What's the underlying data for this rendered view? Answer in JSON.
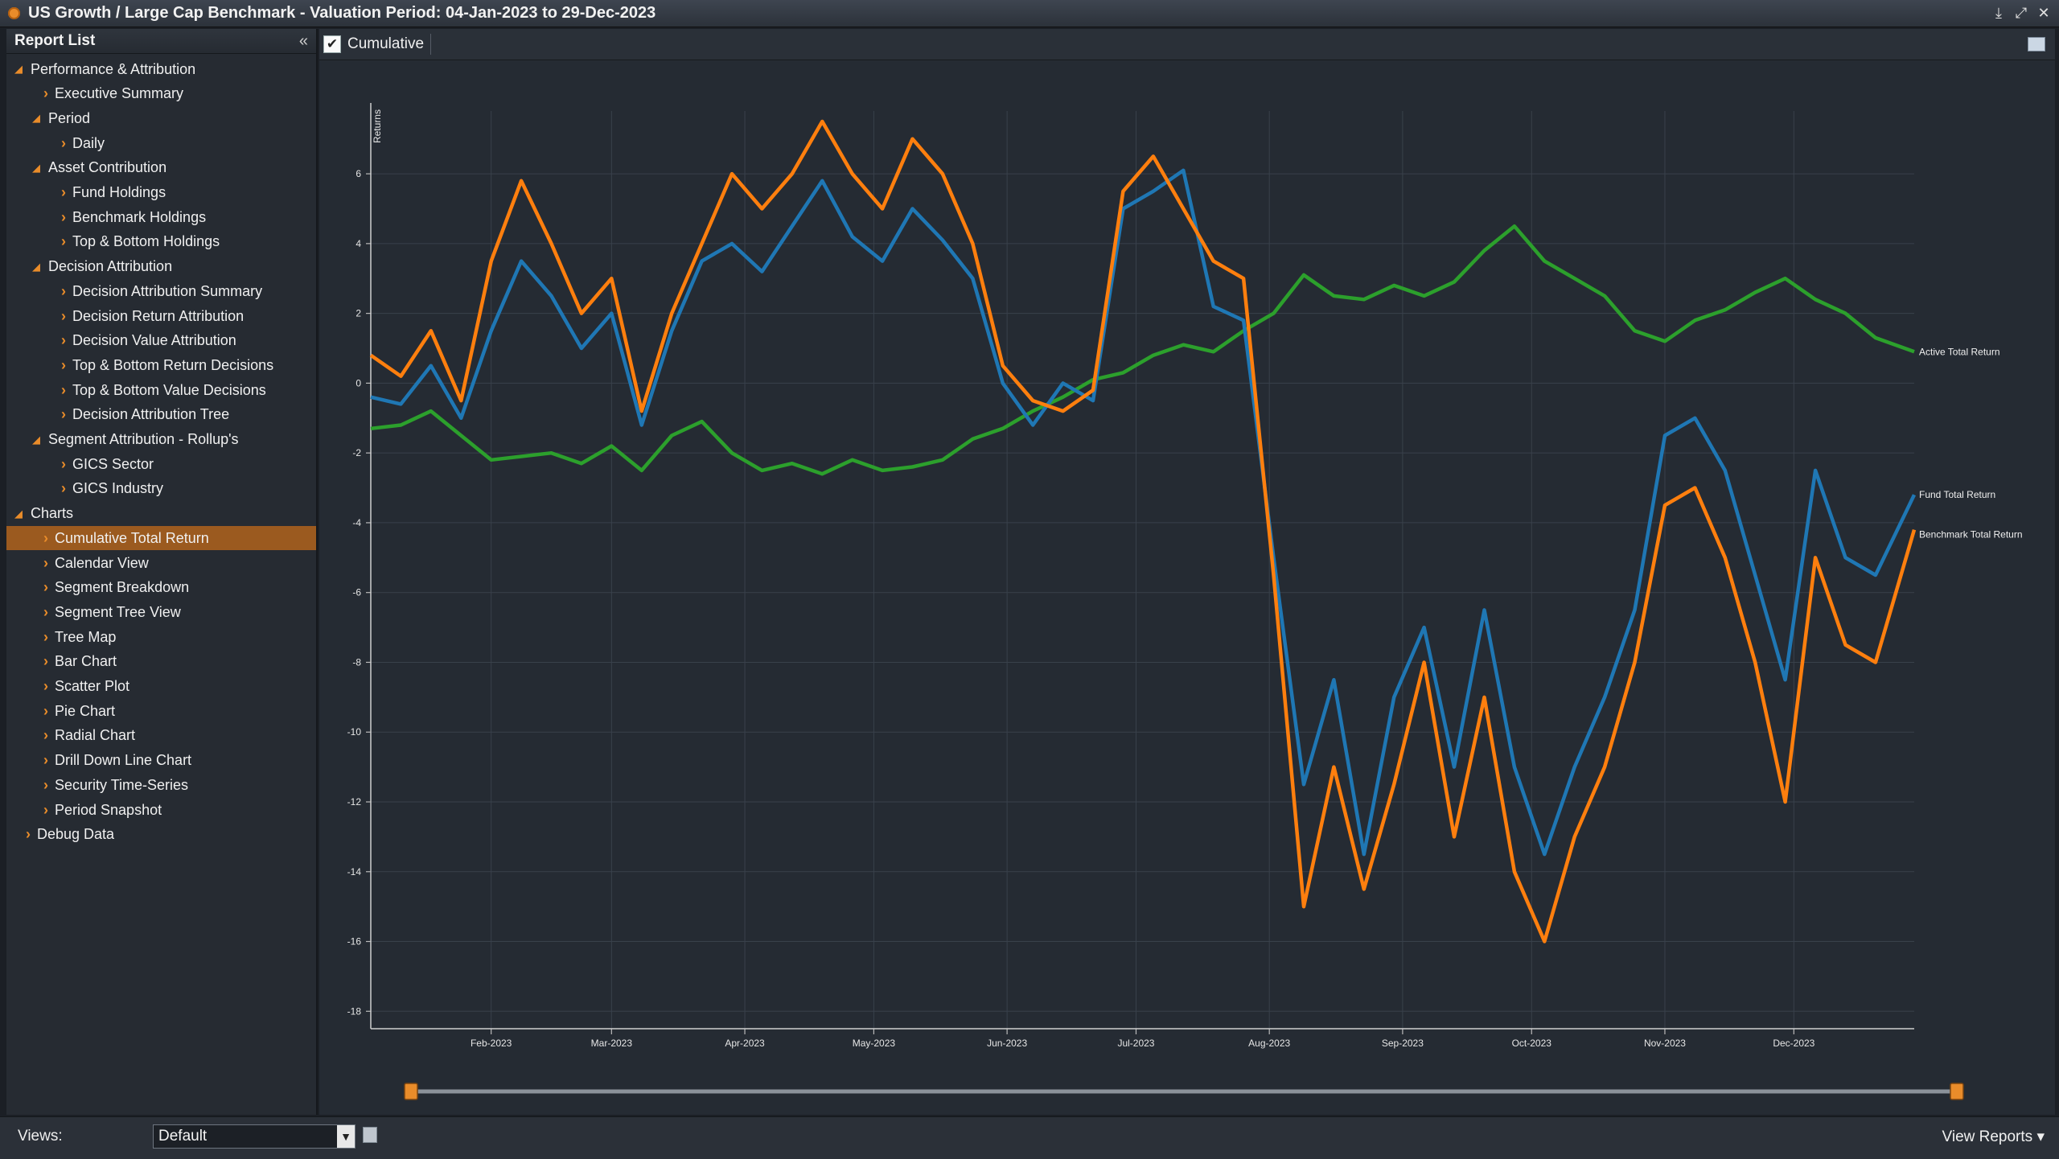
{
  "window": {
    "title": "US Growth / Large Cap Benchmark - Valuation Period: 04-Jan-2023 to 29-Dec-2023",
    "controls": [
      "download-icon",
      "expand-icon",
      "close-icon"
    ]
  },
  "sidebar": {
    "title": "Report List",
    "nodes": [
      {
        "label": "Performance & Attribution",
        "level": 0,
        "kind": "group"
      },
      {
        "label": "Executive Summary",
        "level": 1,
        "kind": "leaf"
      },
      {
        "label": "Period",
        "level": 1,
        "kind": "group"
      },
      {
        "label": "Daily",
        "level": 2,
        "kind": "leaf"
      },
      {
        "label": "Asset Contribution",
        "level": 1,
        "kind": "group"
      },
      {
        "label": "Fund Holdings",
        "level": 2,
        "kind": "leaf"
      },
      {
        "label": "Benchmark Holdings",
        "level": 2,
        "kind": "leaf"
      },
      {
        "label": "Top & Bottom Holdings",
        "level": 2,
        "kind": "leaf"
      },
      {
        "label": "Decision Attribution",
        "level": 1,
        "kind": "group"
      },
      {
        "label": "Decision Attribution Summary",
        "level": 2,
        "kind": "leaf"
      },
      {
        "label": "Decision Return Attribution",
        "level": 2,
        "kind": "leaf"
      },
      {
        "label": "Decision Value Attribution",
        "level": 2,
        "kind": "leaf"
      },
      {
        "label": "Top & Bottom Return Decisions",
        "level": 2,
        "kind": "leaf"
      },
      {
        "label": "Top & Bottom Value Decisions",
        "level": 2,
        "kind": "leaf"
      },
      {
        "label": "Decision Attribution Tree",
        "level": 2,
        "kind": "leaf"
      },
      {
        "label": "Segment Attribution - Rollup's",
        "level": 1,
        "kind": "group"
      },
      {
        "label": "GICS Sector",
        "level": 2,
        "kind": "leaf"
      },
      {
        "label": "GICS Industry",
        "level": 2,
        "kind": "leaf"
      },
      {
        "label": "Charts",
        "level": 0,
        "kind": "group"
      },
      {
        "label": "Cumulative Total Return",
        "level": 1,
        "kind": "leaf",
        "selected": true
      },
      {
        "label": "Calendar View",
        "level": 1,
        "kind": "leaf"
      },
      {
        "label": "Segment Breakdown",
        "level": 1,
        "kind": "leaf"
      },
      {
        "label": "Segment Tree View",
        "level": 1,
        "kind": "leaf"
      },
      {
        "label": "Tree Map",
        "level": 1,
        "kind": "leaf"
      },
      {
        "label": "Bar Chart",
        "level": 1,
        "kind": "leaf"
      },
      {
        "label": "Scatter Plot",
        "level": 1,
        "kind": "leaf"
      },
      {
        "label": "Pie Chart",
        "level": 1,
        "kind": "leaf"
      },
      {
        "label": "Radial Chart",
        "level": 1,
        "kind": "leaf"
      },
      {
        "label": "Drill Down Line Chart",
        "level": 1,
        "kind": "leaf"
      },
      {
        "label": "Security Time-Series",
        "level": 1,
        "kind": "leaf"
      },
      {
        "label": "Period Snapshot",
        "level": 1,
        "kind": "leaf"
      },
      {
        "label": "Debug Data",
        "level": 0,
        "kind": "leaf"
      }
    ]
  },
  "toolbar": {
    "cumulative_label": "Cumulative",
    "cumulative_checked": true
  },
  "footer": {
    "views_label": "Views:",
    "views_value": "Default",
    "view_reports_label": "View Reports"
  },
  "chart_data": {
    "type": "line",
    "ylabel": "Returns",
    "ylim": [
      -18.5,
      7.8
    ],
    "yticks": [
      6,
      4,
      2,
      0,
      -2,
      -4,
      -6,
      -8,
      -10,
      -12,
      -14,
      -16,
      -18
    ],
    "xlim": [
      "2023-01-04",
      "2023-12-29"
    ],
    "xticks": [
      {
        "date": "2023-02-01",
        "label": "Feb-2023"
      },
      {
        "date": "2023-03-01",
        "label": "Mar-2023"
      },
      {
        "date": "2023-04-01",
        "label": "Apr-2023"
      },
      {
        "date": "2023-05-01",
        "label": "May-2023"
      },
      {
        "date": "2023-06-01",
        "label": "Jun-2023"
      },
      {
        "date": "2023-07-01",
        "label": "Jul-2023"
      },
      {
        "date": "2023-08-01",
        "label": "Aug-2023"
      },
      {
        "date": "2023-09-01",
        "label": "Sep-2023"
      },
      {
        "date": "2023-10-01",
        "label": "Oct-2023"
      },
      {
        "date": "2023-11-01",
        "label": "Nov-2023"
      },
      {
        "date": "2023-12-01",
        "label": "Dec-2023"
      }
    ],
    "grid": true,
    "legend": "end-of-line labels",
    "x": [
      "2023-01-04",
      "2023-01-11",
      "2023-01-18",
      "2023-01-25",
      "2023-02-01",
      "2023-02-08",
      "2023-02-15",
      "2023-02-22",
      "2023-03-01",
      "2023-03-08",
      "2023-03-15",
      "2023-03-22",
      "2023-03-29",
      "2023-04-05",
      "2023-04-12",
      "2023-04-19",
      "2023-04-26",
      "2023-05-03",
      "2023-05-10",
      "2023-05-17",
      "2023-05-24",
      "2023-05-31",
      "2023-06-07",
      "2023-06-14",
      "2023-06-21",
      "2023-06-28",
      "2023-07-05",
      "2023-07-12",
      "2023-07-19",
      "2023-07-26",
      "2023-08-02",
      "2023-08-09",
      "2023-08-16",
      "2023-08-23",
      "2023-08-30",
      "2023-09-06",
      "2023-09-13",
      "2023-09-20",
      "2023-09-27",
      "2023-10-04",
      "2023-10-11",
      "2023-10-18",
      "2023-10-25",
      "2023-11-01",
      "2023-11-08",
      "2023-11-15",
      "2023-11-22",
      "2023-11-29",
      "2023-12-06",
      "2023-12-13",
      "2023-12-20",
      "2023-12-29"
    ],
    "series": [
      {
        "name": "Active Total Return",
        "color": "#2ca02c",
        "values": [
          -1.3,
          -1.2,
          -0.8,
          -1.5,
          -2.2,
          -2.1,
          -2.0,
          -2.3,
          -1.8,
          -2.5,
          -1.5,
          -1.1,
          -2.0,
          -2.5,
          -2.3,
          -2.6,
          -2.2,
          -2.5,
          -2.4,
          -2.2,
          -1.6,
          -1.3,
          -0.8,
          -0.4,
          0.1,
          0.3,
          0.8,
          1.1,
          0.9,
          1.5,
          2.0,
          3.1,
          2.5,
          2.4,
          2.8,
          2.5,
          2.9,
          3.8,
          4.5,
          3.5,
          3.0,
          2.5,
          1.5,
          1.2,
          1.8,
          2.1,
          2.6,
          3.0,
          2.4,
          2.0,
          1.3,
          0.9
        ]
      },
      {
        "name": "Fund Total Return",
        "color": "#1f77b4",
        "values": [
          -0.4,
          -0.6,
          0.5,
          -1.0,
          1.5,
          3.5,
          2.5,
          1.0,
          2.0,
          -1.2,
          1.5,
          3.5,
          4.0,
          3.2,
          4.5,
          5.8,
          4.2,
          3.5,
          5.0,
          4.1,
          3.0,
          0.0,
          -1.2,
          0.0,
          -0.5,
          5.0,
          5.5,
          6.1,
          2.2,
          1.8,
          -5.0,
          -11.5,
          -8.5,
          -13.5,
          -9.0,
          -7.0,
          -11.0,
          -6.5,
          -11.0,
          -13.5,
          -11.0,
          -9.0,
          -6.5,
          -1.5,
          -1.0,
          -2.5,
          -5.5,
          -8.5,
          -2.5,
          -5.0,
          -5.5,
          -3.2
        ]
      },
      {
        "name": "Benchmark Total Return",
        "color": "#ff7f0e",
        "values": [
          0.8,
          0.2,
          1.5,
          -0.5,
          3.5,
          5.8,
          4.0,
          2.0,
          3.0,
          -0.8,
          2.0,
          4.0,
          6.0,
          5.0,
          6.0,
          7.5,
          6.0,
          5.0,
          7.0,
          6.0,
          4.0,
          0.5,
          -0.5,
          -0.8,
          -0.2,
          5.5,
          6.5,
          5.0,
          3.5,
          3.0,
          -5.5,
          -15.0,
          -11.0,
          -14.5,
          -11.5,
          -8.0,
          -13.0,
          -9.0,
          -14.0,
          -16.0,
          -13.0,
          -11.0,
          -8.0,
          -3.5,
          -3.0,
          -5.0,
          -8.0,
          -12.0,
          -5.0,
          -7.5,
          -8.0,
          -4.2
        ]
      }
    ]
  },
  "range_slider": {
    "start": 0.0,
    "end": 1.0,
    "handle_color": "#e98c2a"
  }
}
